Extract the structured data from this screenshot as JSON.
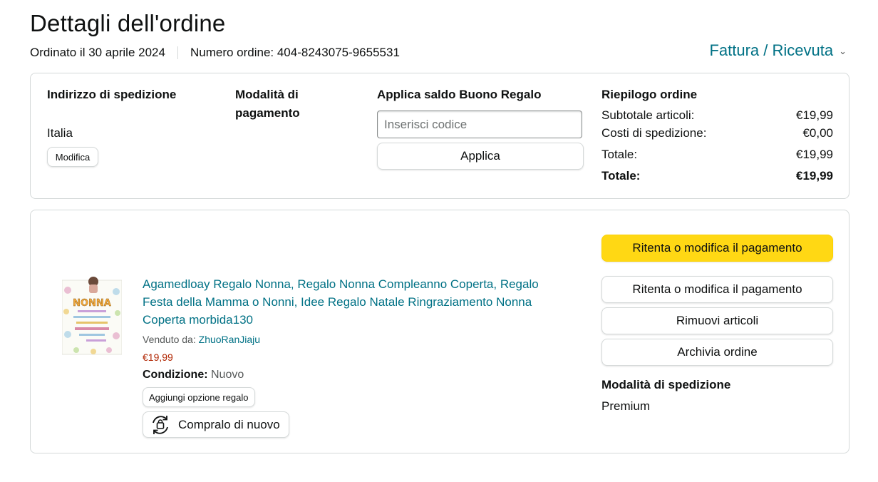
{
  "header": {
    "title": "Dettagli dell'ordine",
    "ordered_on": "Ordinato il 30 aprile 2024",
    "order_number": "Numero ordine: 404-8243075-9655531",
    "invoice_link": "Fattura / Ricevuta",
    "invoice_icon": "chevron-down-icon"
  },
  "shipping_address": {
    "heading": "Indirizzo di spedizione",
    "country": "Italia",
    "edit_button": "Modifica"
  },
  "payment_method": {
    "heading_line1": "Modalità di",
    "heading_line2": "pagamento"
  },
  "gift_card": {
    "heading": "Applica saldo Buono Regalo",
    "placeholder": "Inserisci codice",
    "apply_button": "Applica"
  },
  "summary": {
    "heading": "Riepilogo ordine",
    "rows": [
      {
        "label": "Subtotale articoli:",
        "value": "€19,99"
      },
      {
        "label": "Costi di spedizione:",
        "value": "€0,00"
      },
      {
        "label": "Totale:",
        "value": "€19,99"
      }
    ],
    "grand_total": {
      "label": "Totale:",
      "value": "€19,99"
    }
  },
  "item": {
    "title": "Agamedloay Regalo Nonna, Regalo Nonna Compleanno Coperta, Regalo Festa della Mamma o Nonni, Idee Regalo Natale Ringraziamento Nonna Coperta morbida130",
    "sold_by_label": "Venduto da:",
    "seller": "ZhuoRanJiaju",
    "price": "€19,99",
    "condition_label": "Condizione:",
    "condition_value": "Nuovo",
    "gift_option_button": "Aggiungi opzione regalo",
    "buy_again_button": "Compralo di nuovo",
    "image_text": "NONNA"
  },
  "actions": {
    "retry_primary": "Ritenta o modifica il pagamento",
    "retry_secondary": "Ritenta o modifica il pagamento",
    "remove_items": "Rimuovi articoli",
    "archive_order": "Archivia ordine",
    "shipping_method_heading": "Modalità di spedizione",
    "shipping_method_value": "Premium"
  },
  "colors": {
    "link": "#007185",
    "price": "#b12704",
    "primary_button": "#ffd814",
    "border": "#d5d9d9"
  }
}
